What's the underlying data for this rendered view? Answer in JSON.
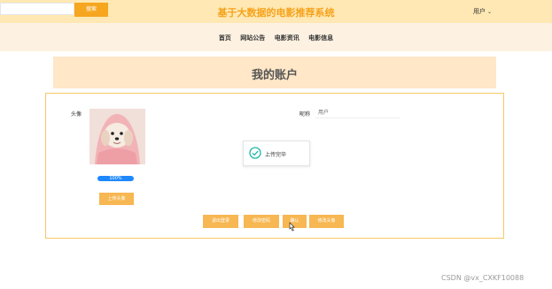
{
  "header": {
    "search_button": "搜索",
    "title": "基于大数据的电影推荐系统",
    "user_menu": "用户"
  },
  "nav": {
    "items": [
      "首页",
      "网站公告",
      "电影资讯",
      "电影信息"
    ]
  },
  "page": {
    "title": "我的账户"
  },
  "account": {
    "avatar_label": "头像",
    "upload_progress": "100%",
    "upload_button": "上传头像",
    "nickname_label": "昵称",
    "nickname_value": "用户",
    "toast_message": "上传完毕"
  },
  "actions": {
    "logout": "退出登录",
    "change_password": "修改密码",
    "confirm": "确认",
    "change_avatar": "修改头像"
  },
  "watermark": "CSDN @vx_CXKF10088",
  "colors": {
    "accent": "#f7a620",
    "header_bg": "#ffe8b3",
    "progress": "#1e88ff"
  },
  "icons": {
    "toast": "check-circle-icon",
    "menu": "chevron-down-icon"
  }
}
